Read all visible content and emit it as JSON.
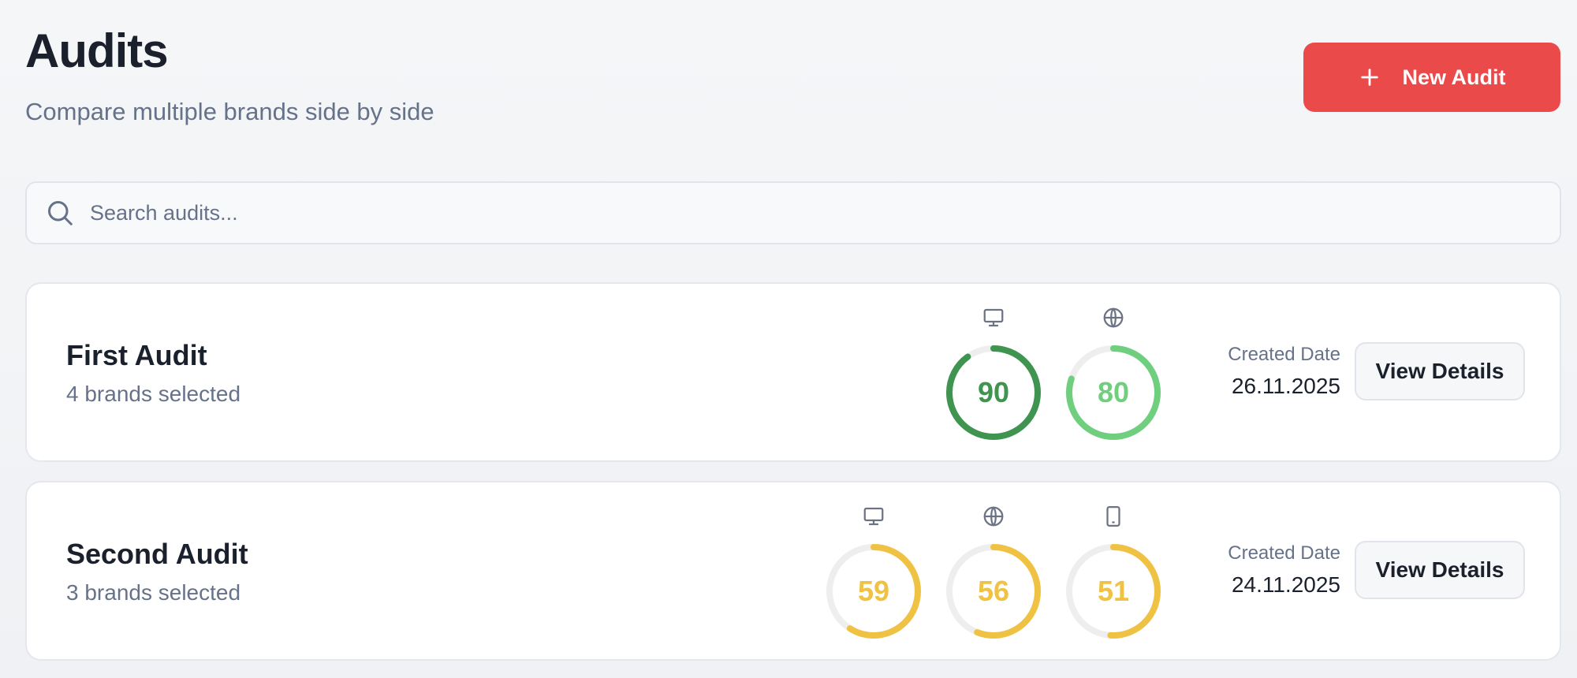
{
  "header": {
    "title": "Audits",
    "subtitle": "Compare multiple brands side by side",
    "new_audit_label": "New Audit",
    "new_audit_icon": "plus-icon"
  },
  "search": {
    "placeholder": "Search audits...",
    "value": "",
    "icon": "search-icon"
  },
  "colors": {
    "accent_red": "#eb4a4a",
    "score_dark_green": "#3f9450",
    "score_light_green": "#6fcf7f",
    "score_yellow": "#f0c244",
    "ring_track": "#eeeeef"
  },
  "audits": [
    {
      "name": "First Audit",
      "brands": "4 brands selected",
      "date_label": "Created Date",
      "date": "26.11.2025",
      "details_label": "View Details",
      "scores": [
        {
          "icon": "desktop-icon",
          "value": 90,
          "color": "#3f9450"
        },
        {
          "icon": "globe-icon",
          "value": 80,
          "color": "#6fcf7f"
        }
      ]
    },
    {
      "name": "Second Audit",
      "brands": "3 brands selected",
      "date_label": "Created Date",
      "date": "24.11.2025",
      "details_label": "View Details",
      "scores": [
        {
          "icon": "desktop-icon",
          "value": 59,
          "color": "#f0c244"
        },
        {
          "icon": "globe-icon",
          "value": 56,
          "color": "#f0c244"
        },
        {
          "icon": "mobile-icon",
          "value": 51,
          "color": "#f0c244"
        }
      ]
    }
  ]
}
